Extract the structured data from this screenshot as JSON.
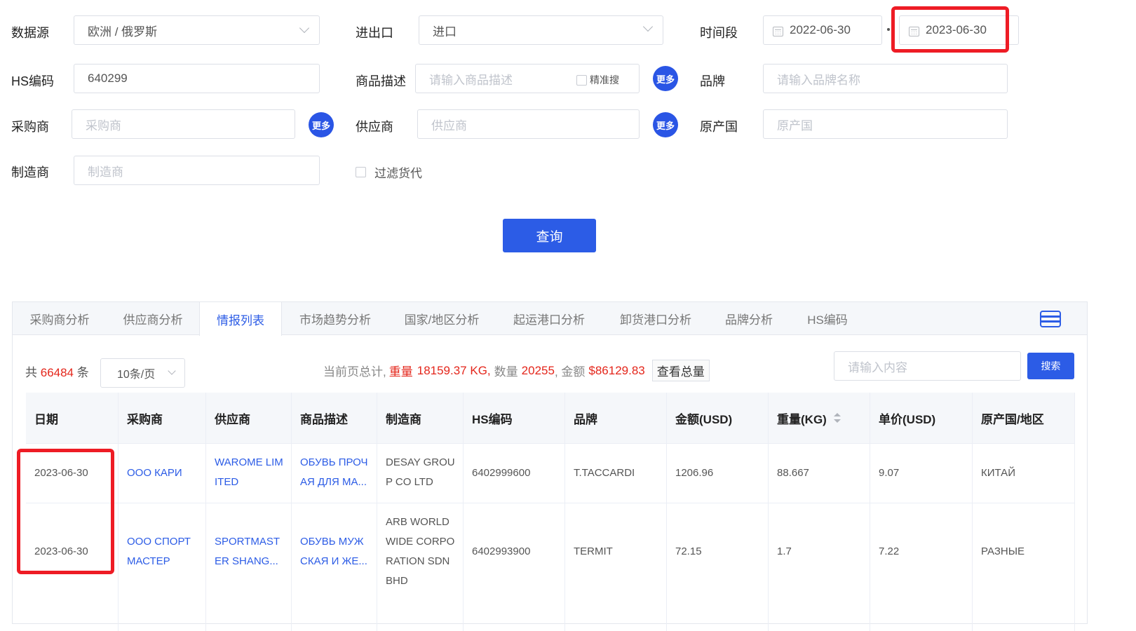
{
  "filters": {
    "datasource": {
      "label": "数据源",
      "value": "欧洲 / 俄罗斯"
    },
    "io": {
      "label": "进出口",
      "value": "进口"
    },
    "period": {
      "label": "时间段",
      "start": "2022-06-30",
      "end": "2023-06-30"
    },
    "hs": {
      "label": "HS编码",
      "value": "640299"
    },
    "desc": {
      "label": "商品描述",
      "placeholder": "请输入商品描述",
      "exact": "精准搜"
    },
    "brand": {
      "label": "品牌",
      "placeholder": "请输入品牌名称"
    },
    "buyer": {
      "label": "采购商",
      "placeholder": "采购商"
    },
    "supplier": {
      "label": "供应商",
      "placeholder": "供应商"
    },
    "origin": {
      "label": "原产国",
      "placeholder": "原产国"
    },
    "maker": {
      "label": "制造商",
      "placeholder": "制造商"
    },
    "filter_forwarder": "过滤货代",
    "more": "更多",
    "query": "查询"
  },
  "tabs": [
    "采购商分析",
    "供应商分析",
    "情报列表",
    "市场趋势分析",
    "国家/地区分析",
    "起运港口分析",
    "卸货港口分析",
    "品牌分析",
    "HS编码"
  ],
  "summary": {
    "total_prefix": "共",
    "total": "66484",
    "total_suffix": "条",
    "page_size": "10条/页",
    "page_total_label": "当前页总计,",
    "weight_label": "重量",
    "weight": "18159.37 KG,",
    "qty_label": "数量",
    "qty": "20255",
    "amount_label": ", 金额",
    "amount": "$86129.83",
    "view_total": "查看总量",
    "search_placeholder": "请输入内容",
    "search": "搜索"
  },
  "table": {
    "headers": [
      "日期",
      "采购商",
      "供应商",
      "商品描述",
      "制造商",
      "HS编码",
      "品牌",
      "金额(USD)",
      "重量(KG)",
      "单价(USD)",
      "原产国/地区"
    ],
    "rows": [
      {
        "date": "2023-06-30",
        "buyer": [
          "OOO КАРИ"
        ],
        "supplier": [
          "WAROME LIM",
          "ITED"
        ],
        "desc": [
          "ОБУВЬ ПРОЧ",
          "АЯ ДЛЯ МА..."
        ],
        "maker": [
          "DESAY GROU",
          "P CO LTD"
        ],
        "hs": "6402999600",
        "brand": "T.TACCARDI",
        "amount": "1206.96",
        "weight": "88.667",
        "price": "9.07",
        "origin": "КИТАЙ"
      },
      {
        "date": "2023-06-30",
        "buyer": [
          "OOO СПОРТ",
          "МАСТЕР"
        ],
        "supplier": [
          "SPORTMAST",
          "ER SHANG..."
        ],
        "desc": [
          "ОБУВЬ МУЖ",
          "СКАЯ И ЖЕ..."
        ],
        "maker": [
          "ARB WORLD",
          "WIDE CORPO",
          "RATION SDN",
          "BHD"
        ],
        "hs": "6402993900",
        "brand": "TERMIT",
        "amount": "72.15",
        "weight": "1.7",
        "price": "7.22",
        "origin": "РАЗНЫЕ"
      }
    ]
  },
  "colors": {
    "accent": "#2c5ce6",
    "highlight": "#ee1c25",
    "summary_red": "#e4261b"
  }
}
